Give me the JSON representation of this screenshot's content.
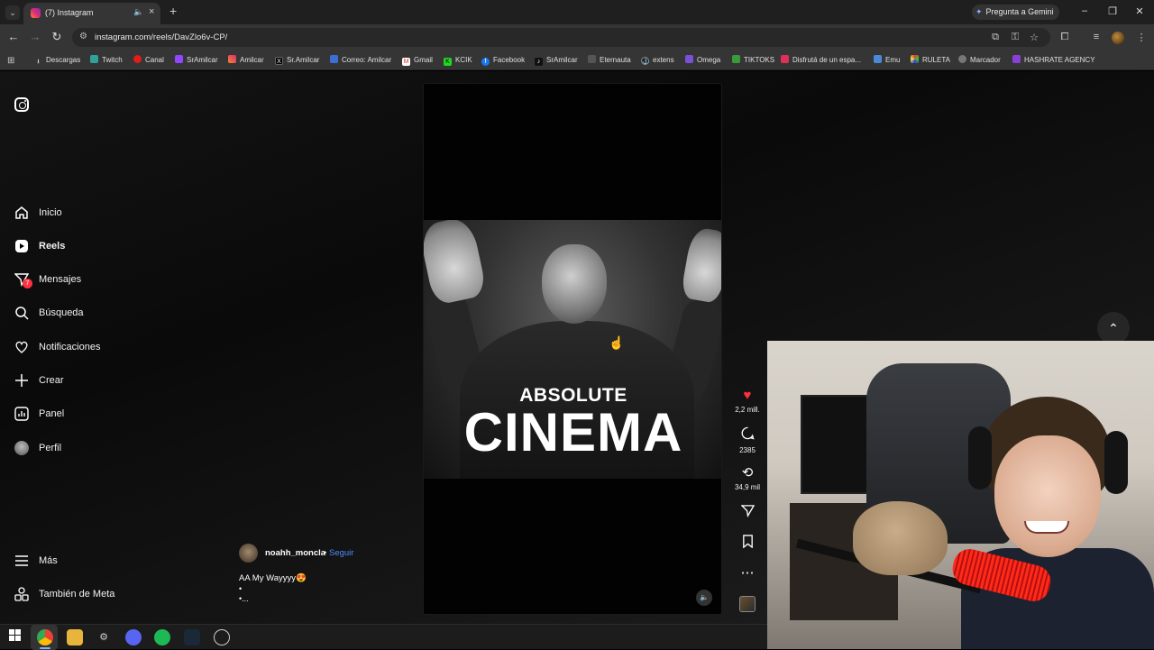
{
  "browser": {
    "tab": {
      "title": "(7) Instagram",
      "audio_icon": "speaker-icon",
      "close": "×"
    },
    "new_tab": "+",
    "gemini_button": "Pregunta a Gemini",
    "window_controls": {
      "minimize": "–",
      "restore": "❐",
      "close": "✕"
    },
    "url": "instagram.com/reels/DavZlo6v-CP/",
    "bookmarks": [
      "Descargas",
      "Twitch",
      "Canal",
      "SrAmilcar",
      "Amilcar",
      "Sr.Amilcar",
      "Correo: Amilcar",
      "Gmail",
      "KCIK",
      "Facebook",
      "SrAmilcar",
      "Eternauta",
      "extens",
      "Omega",
      "TIKTOKS",
      "Disfrutá de un espa...",
      "Emu",
      "RULETA",
      "Marcador",
      "HASHRATE AGENCY"
    ]
  },
  "sidebar": {
    "items": [
      {
        "label": "Inicio",
        "icon": "home-icon"
      },
      {
        "label": "Reels",
        "icon": "reels-icon"
      },
      {
        "label": "Mensajes",
        "icon": "messages-icon",
        "badge": "7"
      },
      {
        "label": "Búsqueda",
        "icon": "search-icon"
      },
      {
        "label": "Notificaciones",
        "icon": "heart-icon"
      },
      {
        "label": "Crear",
        "icon": "plus-icon"
      },
      {
        "label": "Panel",
        "icon": "chart-icon"
      },
      {
        "label": "Perfil",
        "icon": "avatar-icon"
      }
    ],
    "bottom": [
      {
        "label": "Más",
        "icon": "menu-icon"
      },
      {
        "label": "También de Meta",
        "icon": "meta-icon"
      }
    ]
  },
  "reel": {
    "overlay_top": "ABSOLUTE",
    "overlay_main": "CINEMA",
    "username": "noahh_moncla",
    "separator": "•",
    "follow": "Seguir",
    "caption": "AA My Wayyyy😍",
    "caption_lines": [
      "•",
      "•..."
    ],
    "actions": {
      "likes": "2,2 mill.",
      "comments": "2385",
      "reposts": "34,9 mil"
    }
  },
  "colors": {
    "like": "#ff3040",
    "follow_link": "#4c8cff",
    "badge": "#ff3040"
  }
}
